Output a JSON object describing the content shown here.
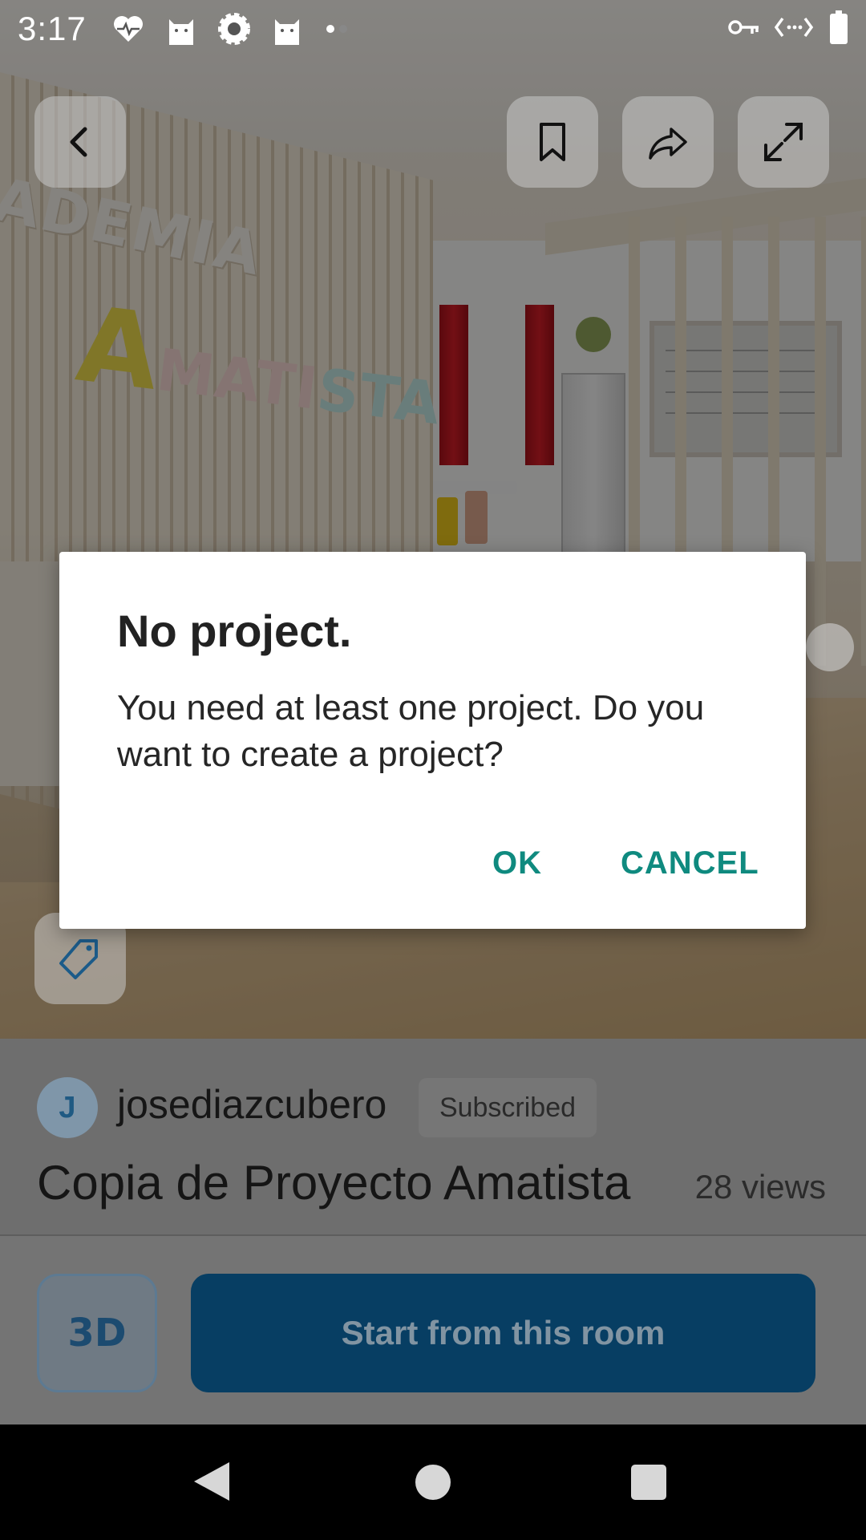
{
  "status_bar": {
    "time": "3:17",
    "left_icons": [
      "heart-pulse-icon",
      "cat-icon",
      "gear-badge-icon",
      "cat-icon",
      "dots-icon"
    ],
    "right_icons": [
      "vpn-key-icon",
      "code-arrows-icon",
      "battery-icon"
    ]
  },
  "hero": {
    "sign_line1": "ADEMIA",
    "sign_line2_a": "A",
    "sign_line2_b": "MATI",
    "sign_line2_c": "STA"
  },
  "top_actions": [
    "back-button",
    "bookmark-button",
    "share-button",
    "fullscreen-button"
  ],
  "info": {
    "avatar_initial": "J",
    "username": "josediazcubero",
    "badge": "Subscribed",
    "project_title": "Copia de Proyecto Amatista",
    "views": "28 views"
  },
  "actions": {
    "three_d_label": "3D",
    "start_label": "Start from this room"
  },
  "dialog": {
    "title": "No project.",
    "message": "You need at least one project. Do you want to create a project?",
    "ok_label": "OK",
    "cancel_label": "CANCEL"
  },
  "colors": {
    "accent": "#0f8a7f",
    "primary_button": "#0a5d94",
    "three_d_text": "#1c70b5"
  }
}
